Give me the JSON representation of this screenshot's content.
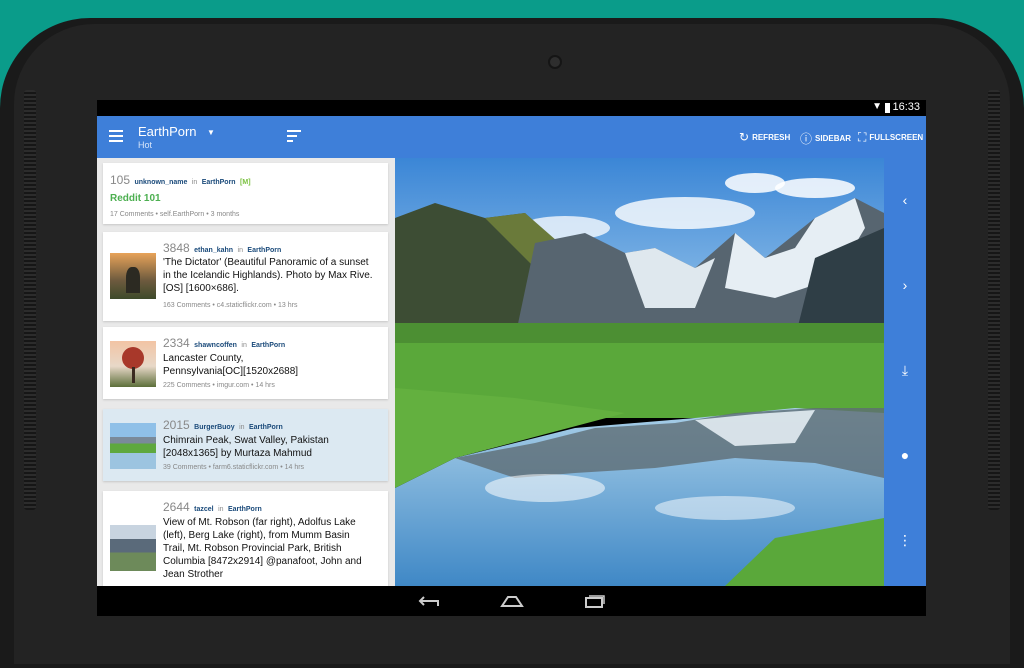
{
  "status": {
    "time": "16:33"
  },
  "appbar": {
    "title": "EarthPorn",
    "subtitle": "Hot",
    "refresh_label": "REFRESH",
    "sidebar_label": "SIDEBAR",
    "fullscreen_label": "FULLSCREEN"
  },
  "posts": [
    {
      "score": "105",
      "user": "unknown_name",
      "in": "in",
      "sub": "EarthPorn",
      "flair": "[M]",
      "title": "Reddit 101",
      "meta": "17 Comments • self.EarthPorn • 3 months"
    },
    {
      "score": "3848",
      "user": "ethan_kahn",
      "in": "in",
      "sub": "EarthPorn",
      "title_lines": [
        "'The Dictator' (Beautiful Panoramic of a sunset",
        "in the Icelandic Highlands). Photo by Max Rive.",
        "[OS] [1600×686]."
      ],
      "meta": "163 Comments • c4.staticflickr.com • 13 hrs"
    },
    {
      "score": "2334",
      "user": "shawncoffen",
      "in": "in",
      "sub": "EarthPorn",
      "title_lines": [
        "Lancaster County,",
        "Pennsylvania[OC][1520x2688]"
      ],
      "meta": "225 Comments • imgur.com • 14 hrs"
    },
    {
      "score": "2015",
      "user": "BurgerBuoy",
      "in": "in",
      "sub": "EarthPorn",
      "title_lines": [
        "Chimrain Peak, Swat Valley, Pakistan",
        "[2048x1365] by Murtaza Mahmud"
      ],
      "meta": "39 Comments • farm6.staticflickr.com • 14 hrs"
    },
    {
      "score": "2644",
      "user": "tazcel",
      "in": "in",
      "sub": "EarthPorn",
      "title_lines": [
        "View of Mt. Robson (far right), Adolfus Lake",
        "(left), Berg Lake (right), from Mumm Basin",
        "Trail, Mt. Robson Provincial Park, British",
        "Columbia [8472x2914] @panafoot, John and",
        "Jean Strother"
      ]
    }
  ],
  "colors": {
    "accent": "#3e7fd9",
    "selected_row": "#dce9f2",
    "link": "#1a4a7a",
    "green": "#4caf50"
  }
}
